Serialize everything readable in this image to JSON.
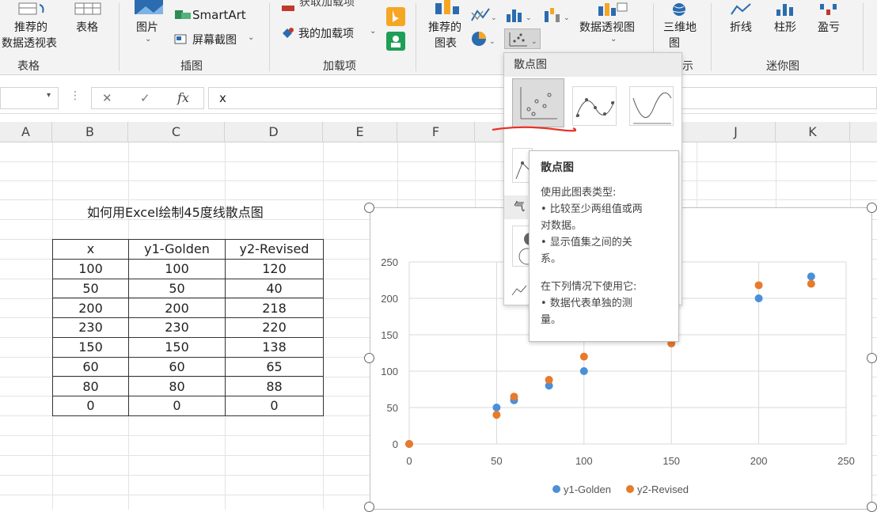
{
  "ribbon": {
    "recommended_pivot": [
      "推荐的",
      "数据透视表"
    ],
    "table": "表格",
    "pictures": "图片",
    "smartart": "SmartArt",
    "screenshot": "屏幕截图",
    "get_addins": "获取加载项",
    "my_addins": "我的加载项",
    "recommended_charts": [
      "推荐的",
      "图表"
    ],
    "pivot_chart": "数据透视图",
    "map_3d": [
      "三维地",
      "图"
    ],
    "spark_line": "折线",
    "spark_column": "柱形",
    "spark_winloss": "盈亏",
    "groups": {
      "tables": "表格",
      "illustrations": "插图",
      "addins": "加载项",
      "demo": "示",
      "sparklines": "迷你图"
    }
  },
  "formula_bar": {
    "cancel": "✕",
    "enter": "✓",
    "fx": "fx",
    "value": "x"
  },
  "columns": [
    "A",
    "B",
    "C",
    "D",
    "E",
    "F",
    "J",
    "K"
  ],
  "sheet": {
    "title": "如何用Excel绘制45度线散点图",
    "headers": [
      "x",
      "y1-Golden",
      "y2-Revised"
    ],
    "rows": [
      [
        "100",
        "100",
        "120"
      ],
      [
        "50",
        "50",
        "40"
      ],
      [
        "200",
        "200",
        "218"
      ],
      [
        "230",
        "230",
        "220"
      ],
      [
        "150",
        "150",
        "138"
      ],
      [
        "60",
        "60",
        "65"
      ],
      [
        "80",
        "80",
        "88"
      ],
      [
        "0",
        "0",
        "0"
      ]
    ]
  },
  "chart_data": {
    "type": "scatter",
    "title": "",
    "xlabel": "",
    "ylabel": "",
    "xlim": [
      0,
      250
    ],
    "ylim": [
      0,
      250
    ],
    "xticks": [
      0,
      50,
      100,
      150,
      200,
      250
    ],
    "yticks": [
      0,
      50,
      100,
      150,
      200,
      250
    ],
    "grid": true,
    "legend_position": "bottom",
    "x": [
      100,
      50,
      200,
      230,
      150,
      60,
      80,
      0
    ],
    "series": [
      {
        "name": "y1-Golden",
        "color": "#4a90d9",
        "values": [
          100,
          50,
          200,
          230,
          150,
          60,
          80,
          0
        ]
      },
      {
        "name": "y2-Revised",
        "color": "#e87a2b",
        "values": [
          120,
          40,
          218,
          220,
          138,
          65,
          88,
          0
        ]
      }
    ]
  },
  "dropdown": {
    "section_scatter": "散点图",
    "section_bubble": "气"
  },
  "tooltip": {
    "title": "散点图",
    "lines": [
      "使用此图表类型:",
      "• 比较至少两组值或两",
      "对数据。",
      "• 显示值集之间的关",
      "系。",
      "",
      "在下列情况下使用它:",
      "• 数据代表单独的测",
      "量。"
    ]
  }
}
